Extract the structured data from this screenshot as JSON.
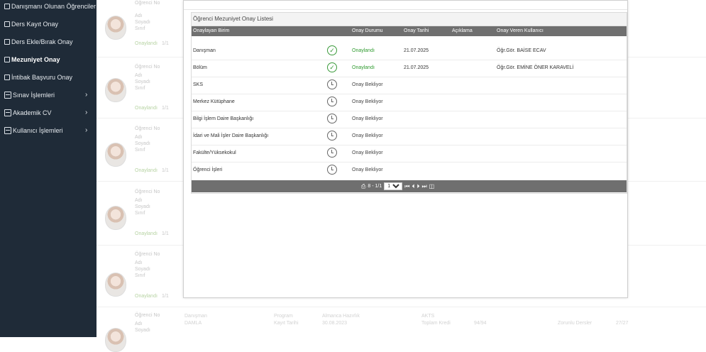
{
  "sidebar": {
    "items": [
      {
        "label": "Danışmanı Olunan Öğrenciler"
      },
      {
        "label": "Ders Kayıt Onay"
      },
      {
        "label": "Ders Ekle/Bırak Onay"
      },
      {
        "label": "Mezuniyet Onay"
      },
      {
        "label": "İntibak Başvuru Onay"
      },
      {
        "label": "Sınav İşlemleri"
      },
      {
        "label": "Akademik CV"
      },
      {
        "label": "Kullanıcı İşlemleri"
      }
    ],
    "chevron": "›"
  },
  "students": {
    "labels": {
      "no": "Öğrenci No",
      "ad": "Adı",
      "soyad": "Soyadı",
      "sinif": "Sınıf"
    },
    "status": "Onaylandı",
    "fraction": "1/1",
    "bottom_texts": [
      "Danışman",
      "DAMLA",
      "Program",
      "Kayıt Tarihi",
      "Almanca Hazırlık",
      "30.08.2023",
      "AKTS",
      "Toplam Kredi",
      "94/94",
      "Zorunlu Dersler",
      "27/27"
    ]
  },
  "modal": {
    "panel_title": "Öğrenci Mezuniyet Onay Listesi",
    "columns": {
      "birim": "Onaylayan Birim",
      "durum": "Onay Durumu",
      "tarih": "Onay Tarihi",
      "aciklama": "Açıklama",
      "kullanici": "Onay Veren Kullanıcı"
    },
    "rows": [
      {
        "birim": "Danışman",
        "durum": "Onaylandı",
        "tarih": "21.07.2025",
        "kullanici": "Öğr.Gör. BAİSE ECAV",
        "icon": "check-circle-icon"
      },
      {
        "birim": "Bölüm",
        "durum": "Onaylandı",
        "tarih": "21.07.2025",
        "kullanici": "Öğr.Gör. EMİNE ÖNER KARAVELİ",
        "icon": "check-circle-icon"
      },
      {
        "birim": "SKS",
        "durum": "Onay Bekliyor",
        "tarih": "",
        "kullanici": "",
        "icon": "clock-icon"
      },
      {
        "birim": "Merkez Kütüphane",
        "durum": "Onay Bekliyor",
        "tarih": "",
        "kullanici": "",
        "icon": "clock-icon"
      },
      {
        "birim": "Bilgi İşlem Daire Başkanlığı",
        "durum": "Onay Bekliyor",
        "tarih": "",
        "kullanici": "",
        "icon": "clock-icon"
      },
      {
        "birim": "İdari ve Mali İşler Daire Başkanlığı",
        "durum": "Onay Bekliyor",
        "tarih": "",
        "kullanici": "",
        "icon": "clock-icon"
      },
      {
        "birim": "Fakülte/Yüksekokul",
        "durum": "Onay Bekliyor",
        "tarih": "",
        "kullanici": "",
        "icon": "clock-icon"
      },
      {
        "birim": "Öğrenci İşleri",
        "durum": "Onay Bekliyor",
        "tarih": "",
        "kullanici": "",
        "icon": "clock-icon"
      }
    ],
    "pager": {
      "range": "8 - 1/1",
      "page": "1",
      "first": "⏮",
      "prev": "⏴",
      "next": "⏵",
      "last": "⏭"
    }
  },
  "colors": {
    "sidebar": "#1f2b38",
    "header": "#6f6f6f",
    "approved": "#2e9a2e"
  }
}
